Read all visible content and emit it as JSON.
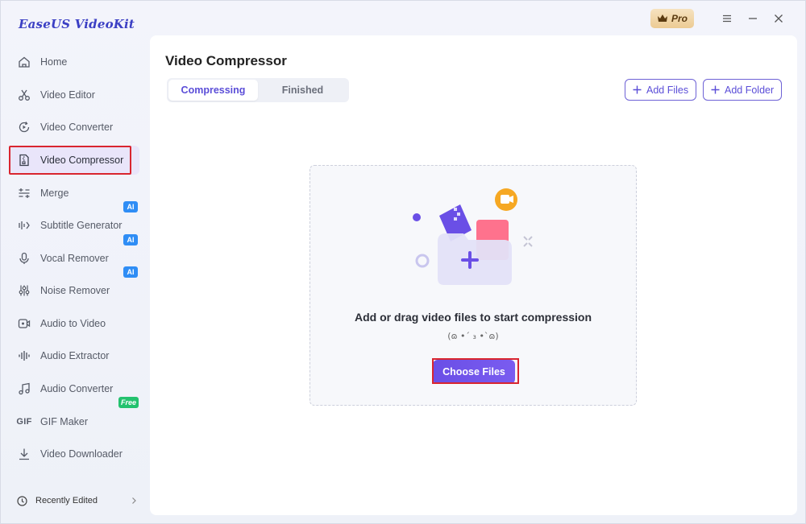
{
  "app": {
    "title": "EaseUS VideoKit",
    "pro_label": "Pro"
  },
  "window_controls": [
    "menu-icon",
    "minimize-icon",
    "close-icon"
  ],
  "sidebar": {
    "items": [
      {
        "label": "Home",
        "icon": "home-icon"
      },
      {
        "label": "Video Editor",
        "icon": "scissors-icon"
      },
      {
        "label": "Video Converter",
        "icon": "convert-icon"
      },
      {
        "label": "Video Compressor",
        "icon": "compress-icon",
        "active": true
      },
      {
        "label": "Merge",
        "icon": "merge-icon"
      },
      {
        "label": "Subtitle Generator",
        "icon": "subtitle-icon",
        "badge": "AI"
      },
      {
        "label": "Vocal Remover",
        "icon": "microphone-icon",
        "badge": "AI"
      },
      {
        "label": "Noise Remover",
        "icon": "noise-icon",
        "badge": "AI"
      },
      {
        "label": "Audio to Video",
        "icon": "audio-video-icon"
      },
      {
        "label": "Audio Extractor",
        "icon": "waveform-icon"
      },
      {
        "label": "Audio Converter",
        "icon": "music-note-icon"
      },
      {
        "label": "GIF Maker",
        "icon": "gif-icon",
        "icon_text": "GIF",
        "badge": "Free"
      },
      {
        "label": "Video Downloader",
        "icon": "download-icon"
      }
    ],
    "recently_edited": "Recently Edited"
  },
  "main": {
    "title": "Video Compressor",
    "tabs": [
      {
        "label": "Compressing",
        "active": true
      },
      {
        "label": "Finished"
      }
    ],
    "add_files_label": "Add Files",
    "add_folder_label": "Add Folder",
    "dropzone": {
      "text": "Add or drag video files to start compression",
      "kaomoji": "(ɷ •ˊ ₃ •ˋɷ)",
      "button_label": "Choose Files"
    }
  },
  "colors": {
    "accent": "#5b4ed8",
    "logo": "#3b3fc4",
    "highlight_box": "#d9252f",
    "ai_badge": "#2f8df5",
    "free_badge": "#23c26e",
    "active_nav_bg": "#e9e5fa"
  }
}
